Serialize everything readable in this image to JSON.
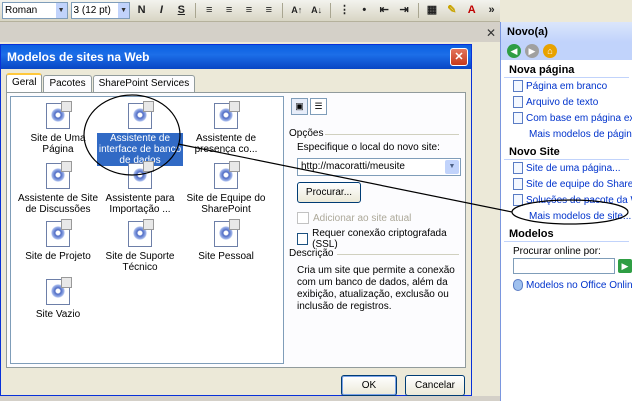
{
  "toolbar": {
    "font_name": "Roman",
    "font_size": "3 (12 pt)",
    "bold": "N",
    "italic": "I",
    "underline": "S"
  },
  "dialog": {
    "title": "Modelos de sites na Web",
    "close_glyph": "✕",
    "tabs": [
      {
        "label": "Geral"
      },
      {
        "label": "Pacotes"
      },
      {
        "label": "SharePoint Services"
      }
    ],
    "templates": [
      {
        "label": "Site de Uma Página"
      },
      {
        "label": "Assistente de interface de banco de dados"
      },
      {
        "label": "Assistente de presença co..."
      },
      {
        "label": "Assistente de Site de Discussões"
      },
      {
        "label": "Assistente para Importação ..."
      },
      {
        "label": "Site de Equipe do SharePoint"
      },
      {
        "label": "Site de Projeto"
      },
      {
        "label": "Site de Suporte Técnico"
      },
      {
        "label": "Site Pessoal"
      },
      {
        "label": "Site Vazio"
      }
    ],
    "options": {
      "group_label": "Opções",
      "location_label": "Especifique o local do novo site:",
      "location_value": "http://macoratti/meusite",
      "browse_button": "Procurar...",
      "add_current_label": "Adicionar ao site atual",
      "ssl_label": "Requer conexão criptografada (SSL)"
    },
    "description": {
      "group_label": "Descrição",
      "text": "Cria um site que permite a conexão com um banco de dados, além da exibição, atualização, exclusão ou inclusão de registros."
    },
    "ok_button": "OK",
    "cancel_button": "Cancelar"
  },
  "taskpane": {
    "title": "Novo(a)",
    "sections": {
      "nova_pagina": "Nova página",
      "novo_site": "Novo Site",
      "modelos": "Modelos"
    },
    "nova_pagina_links": [
      {
        "label": "Página em branco"
      },
      {
        "label": "Arquivo de texto"
      },
      {
        "label": "Com base em página existe"
      }
    ],
    "nova_pagina_more": "Mais modelos de página...",
    "novo_site_links": [
      {
        "label": "Site de uma página..."
      },
      {
        "label": "Site de equipe do SharePoi"
      },
      {
        "label": "Soluções de pacote da We"
      }
    ],
    "novo_site_more": "Mais modelos de site...",
    "search_label": "Procurar online por:",
    "office_online_link": "Modelos no Office Online"
  },
  "colors": {
    "titlebar": "#0a5fe0",
    "selection": "#316ac5",
    "link": "#0033cc",
    "pane_header": "#c1d3fb"
  }
}
